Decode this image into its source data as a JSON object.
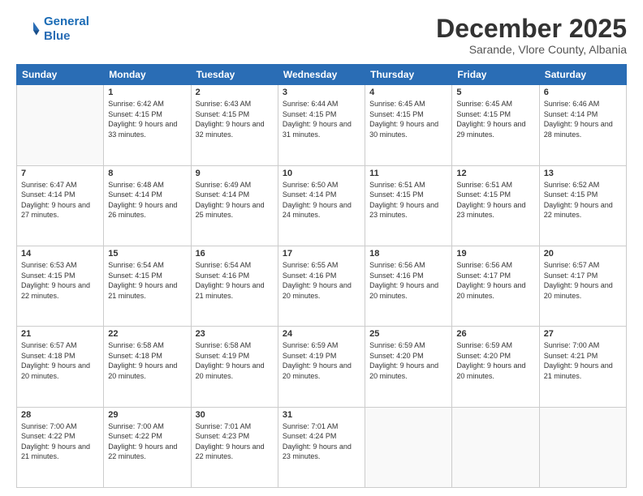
{
  "logo": {
    "line1": "General",
    "line2": "Blue"
  },
  "header": {
    "month": "December 2025",
    "location": "Sarande, Vlore County, Albania"
  },
  "weekdays": [
    "Sunday",
    "Monday",
    "Tuesday",
    "Wednesday",
    "Thursday",
    "Friday",
    "Saturday"
  ],
  "weeks": [
    [
      {
        "day": "",
        "sunrise": "",
        "sunset": "",
        "daylight": ""
      },
      {
        "day": "1",
        "sunrise": "Sunrise: 6:42 AM",
        "sunset": "Sunset: 4:15 PM",
        "daylight": "Daylight: 9 hours and 33 minutes."
      },
      {
        "day": "2",
        "sunrise": "Sunrise: 6:43 AM",
        "sunset": "Sunset: 4:15 PM",
        "daylight": "Daylight: 9 hours and 32 minutes."
      },
      {
        "day": "3",
        "sunrise": "Sunrise: 6:44 AM",
        "sunset": "Sunset: 4:15 PM",
        "daylight": "Daylight: 9 hours and 31 minutes."
      },
      {
        "day": "4",
        "sunrise": "Sunrise: 6:45 AM",
        "sunset": "Sunset: 4:15 PM",
        "daylight": "Daylight: 9 hours and 30 minutes."
      },
      {
        "day": "5",
        "sunrise": "Sunrise: 6:45 AM",
        "sunset": "Sunset: 4:15 PM",
        "daylight": "Daylight: 9 hours and 29 minutes."
      },
      {
        "day": "6",
        "sunrise": "Sunrise: 6:46 AM",
        "sunset": "Sunset: 4:14 PM",
        "daylight": "Daylight: 9 hours and 28 minutes."
      }
    ],
    [
      {
        "day": "7",
        "sunrise": "Sunrise: 6:47 AM",
        "sunset": "Sunset: 4:14 PM",
        "daylight": "Daylight: 9 hours and 27 minutes."
      },
      {
        "day": "8",
        "sunrise": "Sunrise: 6:48 AM",
        "sunset": "Sunset: 4:14 PM",
        "daylight": "Daylight: 9 hours and 26 minutes."
      },
      {
        "day": "9",
        "sunrise": "Sunrise: 6:49 AM",
        "sunset": "Sunset: 4:14 PM",
        "daylight": "Daylight: 9 hours and 25 minutes."
      },
      {
        "day": "10",
        "sunrise": "Sunrise: 6:50 AM",
        "sunset": "Sunset: 4:14 PM",
        "daylight": "Daylight: 9 hours and 24 minutes."
      },
      {
        "day": "11",
        "sunrise": "Sunrise: 6:51 AM",
        "sunset": "Sunset: 4:15 PM",
        "daylight": "Daylight: 9 hours and 23 minutes."
      },
      {
        "day": "12",
        "sunrise": "Sunrise: 6:51 AM",
        "sunset": "Sunset: 4:15 PM",
        "daylight": "Daylight: 9 hours and 23 minutes."
      },
      {
        "day": "13",
        "sunrise": "Sunrise: 6:52 AM",
        "sunset": "Sunset: 4:15 PM",
        "daylight": "Daylight: 9 hours and 22 minutes."
      }
    ],
    [
      {
        "day": "14",
        "sunrise": "Sunrise: 6:53 AM",
        "sunset": "Sunset: 4:15 PM",
        "daylight": "Daylight: 9 hours and 22 minutes."
      },
      {
        "day": "15",
        "sunrise": "Sunrise: 6:54 AM",
        "sunset": "Sunset: 4:15 PM",
        "daylight": "Daylight: 9 hours and 21 minutes."
      },
      {
        "day": "16",
        "sunrise": "Sunrise: 6:54 AM",
        "sunset": "Sunset: 4:16 PM",
        "daylight": "Daylight: 9 hours and 21 minutes."
      },
      {
        "day": "17",
        "sunrise": "Sunrise: 6:55 AM",
        "sunset": "Sunset: 4:16 PM",
        "daylight": "Daylight: 9 hours and 20 minutes."
      },
      {
        "day": "18",
        "sunrise": "Sunrise: 6:56 AM",
        "sunset": "Sunset: 4:16 PM",
        "daylight": "Daylight: 9 hours and 20 minutes."
      },
      {
        "day": "19",
        "sunrise": "Sunrise: 6:56 AM",
        "sunset": "Sunset: 4:17 PM",
        "daylight": "Daylight: 9 hours and 20 minutes."
      },
      {
        "day": "20",
        "sunrise": "Sunrise: 6:57 AM",
        "sunset": "Sunset: 4:17 PM",
        "daylight": "Daylight: 9 hours and 20 minutes."
      }
    ],
    [
      {
        "day": "21",
        "sunrise": "Sunrise: 6:57 AM",
        "sunset": "Sunset: 4:18 PM",
        "daylight": "Daylight: 9 hours and 20 minutes."
      },
      {
        "day": "22",
        "sunrise": "Sunrise: 6:58 AM",
        "sunset": "Sunset: 4:18 PM",
        "daylight": "Daylight: 9 hours and 20 minutes."
      },
      {
        "day": "23",
        "sunrise": "Sunrise: 6:58 AM",
        "sunset": "Sunset: 4:19 PM",
        "daylight": "Daylight: 9 hours and 20 minutes."
      },
      {
        "day": "24",
        "sunrise": "Sunrise: 6:59 AM",
        "sunset": "Sunset: 4:19 PM",
        "daylight": "Daylight: 9 hours and 20 minutes."
      },
      {
        "day": "25",
        "sunrise": "Sunrise: 6:59 AM",
        "sunset": "Sunset: 4:20 PM",
        "daylight": "Daylight: 9 hours and 20 minutes."
      },
      {
        "day": "26",
        "sunrise": "Sunrise: 6:59 AM",
        "sunset": "Sunset: 4:20 PM",
        "daylight": "Daylight: 9 hours and 20 minutes."
      },
      {
        "day": "27",
        "sunrise": "Sunrise: 7:00 AM",
        "sunset": "Sunset: 4:21 PM",
        "daylight": "Daylight: 9 hours and 21 minutes."
      }
    ],
    [
      {
        "day": "28",
        "sunrise": "Sunrise: 7:00 AM",
        "sunset": "Sunset: 4:22 PM",
        "daylight": "Daylight: 9 hours and 21 minutes."
      },
      {
        "day": "29",
        "sunrise": "Sunrise: 7:00 AM",
        "sunset": "Sunset: 4:22 PM",
        "daylight": "Daylight: 9 hours and 22 minutes."
      },
      {
        "day": "30",
        "sunrise": "Sunrise: 7:01 AM",
        "sunset": "Sunset: 4:23 PM",
        "daylight": "Daylight: 9 hours and 22 minutes."
      },
      {
        "day": "31",
        "sunrise": "Sunrise: 7:01 AM",
        "sunset": "Sunset: 4:24 PM",
        "daylight": "Daylight: 9 hours and 23 minutes."
      },
      {
        "day": "",
        "sunrise": "",
        "sunset": "",
        "daylight": ""
      },
      {
        "day": "",
        "sunrise": "",
        "sunset": "",
        "daylight": ""
      },
      {
        "day": "",
        "sunrise": "",
        "sunset": "",
        "daylight": ""
      }
    ]
  ]
}
